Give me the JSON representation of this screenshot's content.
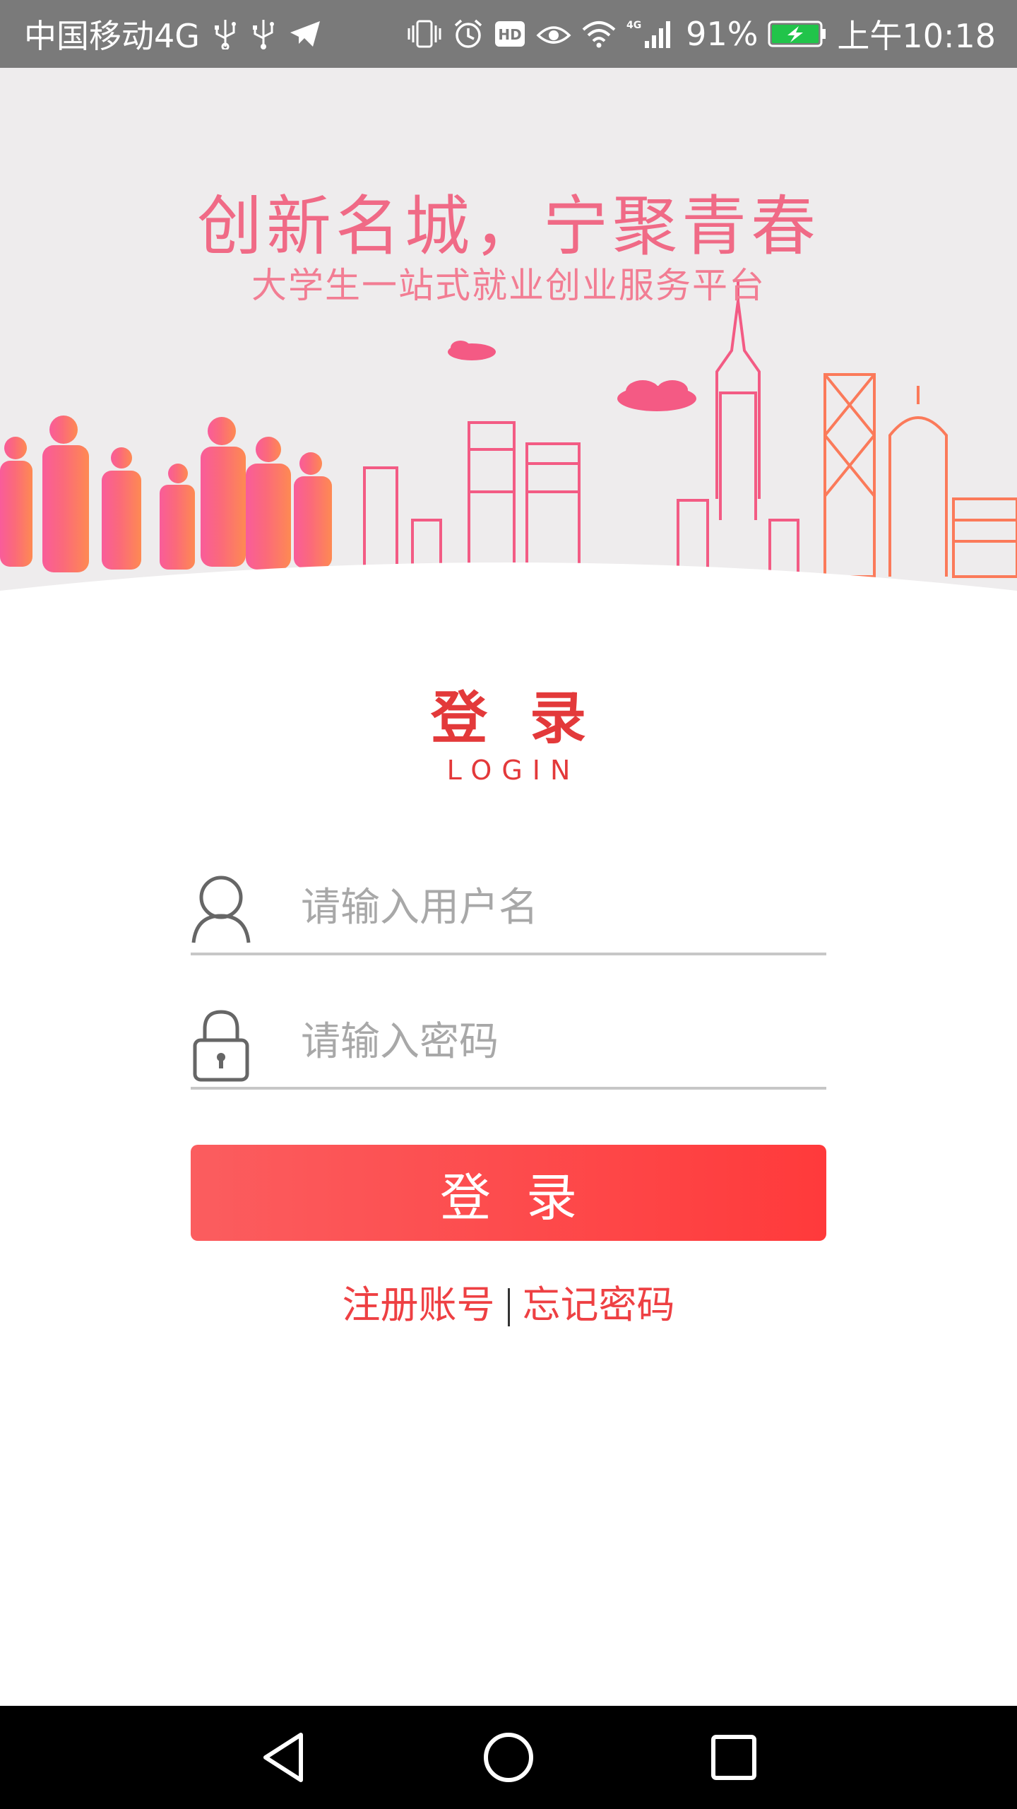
{
  "status_bar": {
    "carrier": "中国移动4G",
    "battery_percent": "91%",
    "time": "上午10:18",
    "icons_left": [
      "usb-icon",
      "usb-icon",
      "send-icon"
    ],
    "icons_right": [
      "vibrate-icon",
      "alarm-icon",
      "hd-icon",
      "eye-icon",
      "wifi-icon",
      "signal-4g-icon",
      "battery-charging-icon"
    ]
  },
  "banner": {
    "title": "创新名城，宁聚青春",
    "subtitle": "大学生一站式就业创业服务平台"
  },
  "login": {
    "heading": "登录",
    "heading_en": "LOGIN",
    "username_placeholder": "请输入用户名",
    "password_placeholder": "请输入密码",
    "submit_label": "登录",
    "register_link": "注册账号",
    "forgot_link": "忘记密码"
  },
  "colors": {
    "accent": "#e3393a",
    "button_start": "#fb5d5f",
    "button_end": "#ff3a3b",
    "banner_bg": "#eeeced",
    "status_bar_bg": "#7a7a7a"
  },
  "nav_bar": {
    "buttons": [
      "back-icon",
      "home-icon",
      "recents-icon"
    ]
  }
}
